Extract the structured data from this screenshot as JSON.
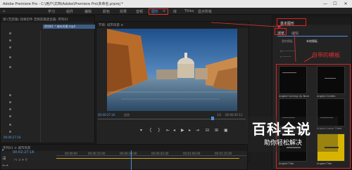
{
  "window": {
    "title": "Adobe Premiere Pro - C:\\用户\\文档\\Adobe\\Premiere Pro\\未命名.prproj *",
    "min": "—",
    "max": "☐",
    "close": "✕"
  },
  "workspaces": [
    {
      "label": "学习"
    },
    {
      "label": "组件"
    },
    {
      "label": "编辑"
    },
    {
      "label": "颜色"
    },
    {
      "label": "效果"
    },
    {
      "label": "音频"
    },
    {
      "label": "图形",
      "active": true
    },
    {
      "label": "库"
    },
    {
      "label": "Titles"
    },
    {
      "label": "显示所有"
    }
  ],
  "left_panel": {
    "header": "源:(无剪辑)  效果控件  音频剪辑混合器: 序列01",
    "source_label": "序列01 * 城市风景.mp4",
    "time": "00:00:27:16"
  },
  "monitor": {
    "header": "节目: 城市风景  ≡",
    "timecode": "00:00:27:16",
    "fit": "适合",
    "ratio": "1/2",
    "duration": "00:00:45:11"
  },
  "essential_graphics": {
    "header": "基本图形",
    "tab_browse": "浏览",
    "tab_edit": "编辑",
    "my_templates": "我的模板",
    "local_templates": "本地模板",
    "annotation": "自带的模板",
    "templates": [
      {
        "name": "Angled Coming Up Next"
      },
      {
        "name": "Angled Credits"
      },
      {
        "name": "Angled Lower Third"
      },
      {
        "name": "Angled Lower Third"
      },
      {
        "name": "Angled Title"
      },
      {
        "name": "Angled Title"
      }
    ]
  },
  "timeline": {
    "header": "序列01 ≡  城市风景",
    "time": "00:02:27:16",
    "ruler": [
      "00:00:00",
      "00:00:15:00",
      "00:00:30:00",
      "00:00:45:00",
      "00:01:00:00",
      "00:01:15:00"
    ]
  },
  "watermark": {
    "title": "百科全说",
    "subtitle": "助你轻松解决"
  }
}
